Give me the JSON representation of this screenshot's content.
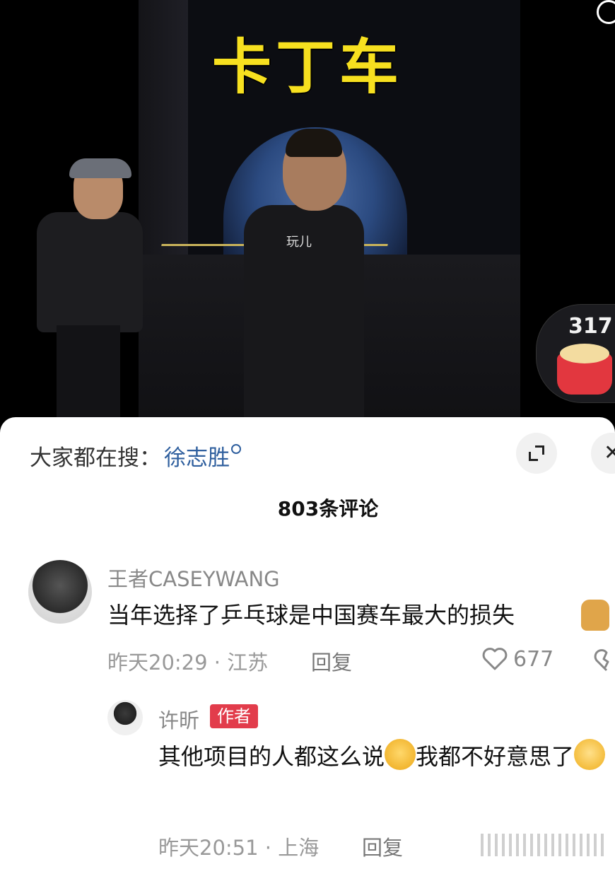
{
  "video": {
    "title": "卡丁车",
    "shirt_text": "玩儿",
    "gift": {
      "count": "317"
    }
  },
  "search": {
    "prefix": "大家都在搜：",
    "term": "徐志胜"
  },
  "comments_header": {
    "count_label": "803条评论"
  },
  "comments": [
    {
      "username": "王者CASEYWANG",
      "text": "当年选择了乒乓球是中国赛车最大的损失",
      "time_location": "昨天20:29 · 江苏",
      "reply_label": "回复",
      "likes": "677"
    }
  ],
  "reply": {
    "username": "许昕",
    "badge": "作者",
    "text_part1": "其他项目的人都这么说",
    "text_part2": "我都不好意思了",
    "time_location": "昨天20:51 · 上海",
    "reply_label": "回复"
  }
}
